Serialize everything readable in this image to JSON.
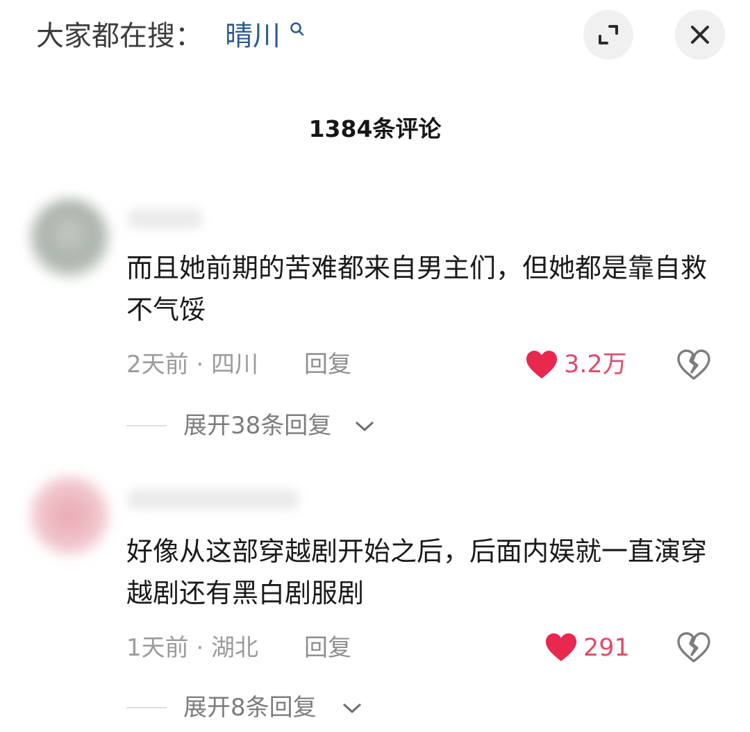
{
  "header": {
    "search_prefix": "大家都在搜：",
    "search_term": "晴川",
    "expand_icon": "expand-icon",
    "close_icon": "close-icon"
  },
  "comment_count": "1384条评论",
  "comments": [
    {
      "text": "而且她前期的苦难都来自男主们，但她都是靠自救不气馁",
      "meta": "2天前 · 四川",
      "reply_label": "回复",
      "likes": "3.2万",
      "expand_label": "展开38条回复"
    },
    {
      "text": "好像从这部穿越剧开始之后，后面内娱就一直演穿越剧还有黑白剧服剧",
      "meta": "1天前 · 湖北",
      "reply_label": "回复",
      "likes": "291",
      "expand_label": "展开8条回复"
    }
  ],
  "colors": {
    "like": "#e14a6a",
    "search_term": "#2e5a91",
    "text": "#1a1a1a",
    "muted": "#9b9b9b"
  }
}
